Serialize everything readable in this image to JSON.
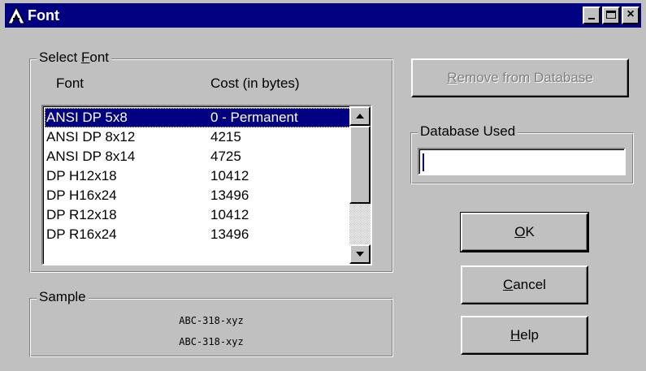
{
  "window": {
    "title": "Font"
  },
  "select_font": {
    "legend_pre": "Select ",
    "legend_key": "F",
    "legend_post": "ont",
    "col_font": "Font",
    "col_cost": "Cost (in bytes)",
    "rows": [
      {
        "font": "ANSI DP 5x8",
        "cost": "0 - Permanent"
      },
      {
        "font": "ANSI DP 8x12",
        "cost": "4215"
      },
      {
        "font": "ANSI DP 8x14",
        "cost": "4725"
      },
      {
        "font": "DP H12x18",
        "cost": "10412"
      },
      {
        "font": "DP H16x24",
        "cost": "13496"
      },
      {
        "font": "DP R12x18",
        "cost": "10412"
      },
      {
        "font": "DP R16x24",
        "cost": "13496"
      }
    ],
    "selected_index": 0
  },
  "sample": {
    "legend": "Sample",
    "line1": "ABC-318-xyz",
    "line2": "ABC-318-xyz"
  },
  "remove_button": {
    "key": "R",
    "rest": "emove from Database"
  },
  "database_used": {
    "legend": "Database Used",
    "value": ""
  },
  "ok_button": {
    "key": "O",
    "rest": "K"
  },
  "cancel_button": {
    "key": "C",
    "rest": "ancel"
  },
  "help_button": {
    "key": "H",
    "rest": "elp"
  },
  "colors": {
    "title_bar": "#000080",
    "face": "#c0c0c0",
    "selection": "#000080"
  }
}
